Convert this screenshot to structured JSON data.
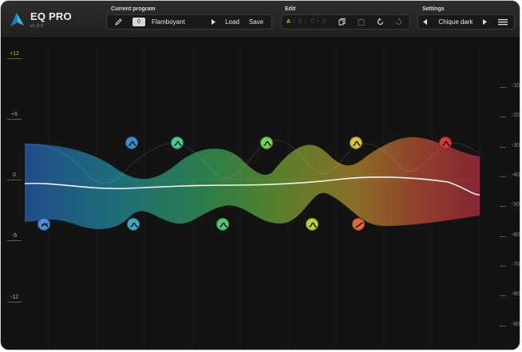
{
  "app": {
    "title": "EQ PRO",
    "version": "v1.0.0"
  },
  "header": {
    "current_program": {
      "label": "Current program",
      "number": "0",
      "name": "Flamboyant",
      "load_label": "Load",
      "save_label": "Save"
    },
    "edit": {
      "label": "Edit",
      "slots": [
        "A",
        "B",
        "C",
        "D"
      ],
      "separators": [
        "/",
        "/",
        "/"
      ],
      "active_slot": "A"
    },
    "settings": {
      "label": "Settings",
      "theme": "Chique dark"
    }
  },
  "graph": {
    "gain_labels": [
      "+12",
      "+6",
      "0",
      "-6",
      "-12"
    ],
    "db_labels": [
      "-10",
      "-20",
      "-30",
      "-40",
      "-50",
      "-60",
      "-70",
      "-80",
      "-90"
    ],
    "colors": {
      "background": "#131313",
      "gain_label": "#e0a64a",
      "response_curve": "#f0f0f0"
    },
    "band_nodes": [
      {
        "color": "#4b8fd6",
        "icon": "high-shelf-icon"
      },
      {
        "color": "#3d8fd0",
        "icon": "bell-icon"
      },
      {
        "color": "#43a8c2",
        "icon": "bell-icon"
      },
      {
        "color": "#4fc88b",
        "icon": "bell-icon"
      },
      {
        "color": "#59c76d",
        "icon": "bell-icon"
      },
      {
        "color": "#79d051",
        "icon": "bell-icon"
      },
      {
        "color": "#b7d23c",
        "icon": "bell-icon"
      },
      {
        "color": "#d9c33d",
        "icon": "bell-icon"
      },
      {
        "color": "#dc6a3e",
        "icon": "low-shelf-icon"
      },
      {
        "color": "#cf3a44",
        "icon": "bell-icon"
      }
    ]
  }
}
